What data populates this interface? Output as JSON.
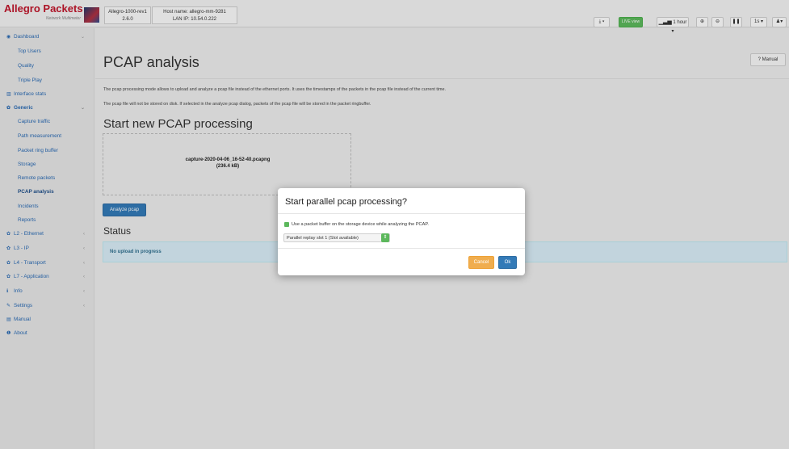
{
  "brand": {
    "name": "Allegro Packets",
    "subtitle": "Network Multimeter"
  },
  "header": {
    "device": {
      "name": "Allegro-1000-rev1",
      "version": "2.6.0"
    },
    "host": {
      "hostname": "Host name: allegro-mm-9281",
      "lan_ip": "LAN IP: 10.54.0.222"
    },
    "download_label": "⤓ ▾",
    "live_label": "LIVE view",
    "range_label": "1 hour ▾",
    "interval_label": "1s ▾",
    "user_label": "▾"
  },
  "sidebar": {
    "items": [
      {
        "label": "Dashboard",
        "icon": "dashboard-icon",
        "glyph": "◉",
        "level": "top"
      },
      {
        "label": "Top Users",
        "level": "sub"
      },
      {
        "label": "Quality",
        "level": "sub"
      },
      {
        "label": "Triple Play",
        "level": "sub"
      },
      {
        "label": "Interface stats",
        "icon": "bar-chart-icon",
        "glyph": "▥",
        "level": "top"
      },
      {
        "label": "Generic",
        "icon": "gear-icon",
        "glyph": "✿",
        "level": "group"
      },
      {
        "label": "Capture traffic",
        "level": "sub"
      },
      {
        "label": "Path measurement",
        "level": "sub"
      },
      {
        "label": "Packet ring buffer",
        "level": "sub"
      },
      {
        "label": "Storage",
        "level": "sub"
      },
      {
        "label": "Remote packets",
        "level": "sub"
      },
      {
        "label": "PCAP analysis",
        "level": "sub",
        "active": true
      },
      {
        "label": "Incidents",
        "level": "sub"
      },
      {
        "label": "Reports",
        "level": "sub"
      },
      {
        "label": "L2 - Ethernet",
        "icon": "gear-icon",
        "glyph": "✿",
        "level": "top"
      },
      {
        "label": "L3 - IP",
        "icon": "gear-icon",
        "glyph": "✿",
        "level": "top"
      },
      {
        "label": "L4 - Transport",
        "icon": "gear-icon",
        "glyph": "✿",
        "level": "top"
      },
      {
        "label": "L7 - Application",
        "icon": "gear-icon",
        "glyph": "✿",
        "level": "top"
      },
      {
        "label": "Info",
        "icon": "info-icon",
        "glyph": "ℹ",
        "level": "top"
      },
      {
        "label": "Settings",
        "icon": "wrench-icon",
        "glyph": "✎",
        "level": "top"
      },
      {
        "label": "Manual",
        "icon": "book-icon",
        "glyph": "▤",
        "level": "top"
      },
      {
        "label": "About",
        "icon": "info-circle-icon",
        "glyph": "❶",
        "level": "top"
      }
    ]
  },
  "page": {
    "title": "PCAP analysis",
    "manual_label": "? Manual",
    "description_1": "The pcap processing mode allows to upload and analyze a pcap file instead of the ethernet ports. It uses the timestamps of the packets in the pcap file instead of the current time.",
    "description_2": "The pcap file will not be stored on disk. If selected in the analyze pcap dialog, packets of the pcap file will be stored in the packet ringbuffer.",
    "section_title": "Start new PCAP processing",
    "file": {
      "name": "capture-2020-04-06_16-52-40.pcapng",
      "size": "(236.4 kB)"
    },
    "analyze_label": "Analyze pcap",
    "status_title": "Status",
    "status_text": "No upload in progress"
  },
  "modal": {
    "title": "Start parallel pcap processing?",
    "checkbox_label": "Use a packet buffer on the storage device while analyzing the PCAP.",
    "checkbox_checked": true,
    "select_value": "Parallel replay slot 1 (Slot available)",
    "cancel_label": "Cancel",
    "ok_label": "Ok"
  },
  "colors": {
    "brand": "#c0162b",
    "link": "#2a6ab3",
    "primary": "#337ab7",
    "warning": "#f0ad4e",
    "success": "#5cb85c",
    "info_bg": "#d9edf7"
  }
}
